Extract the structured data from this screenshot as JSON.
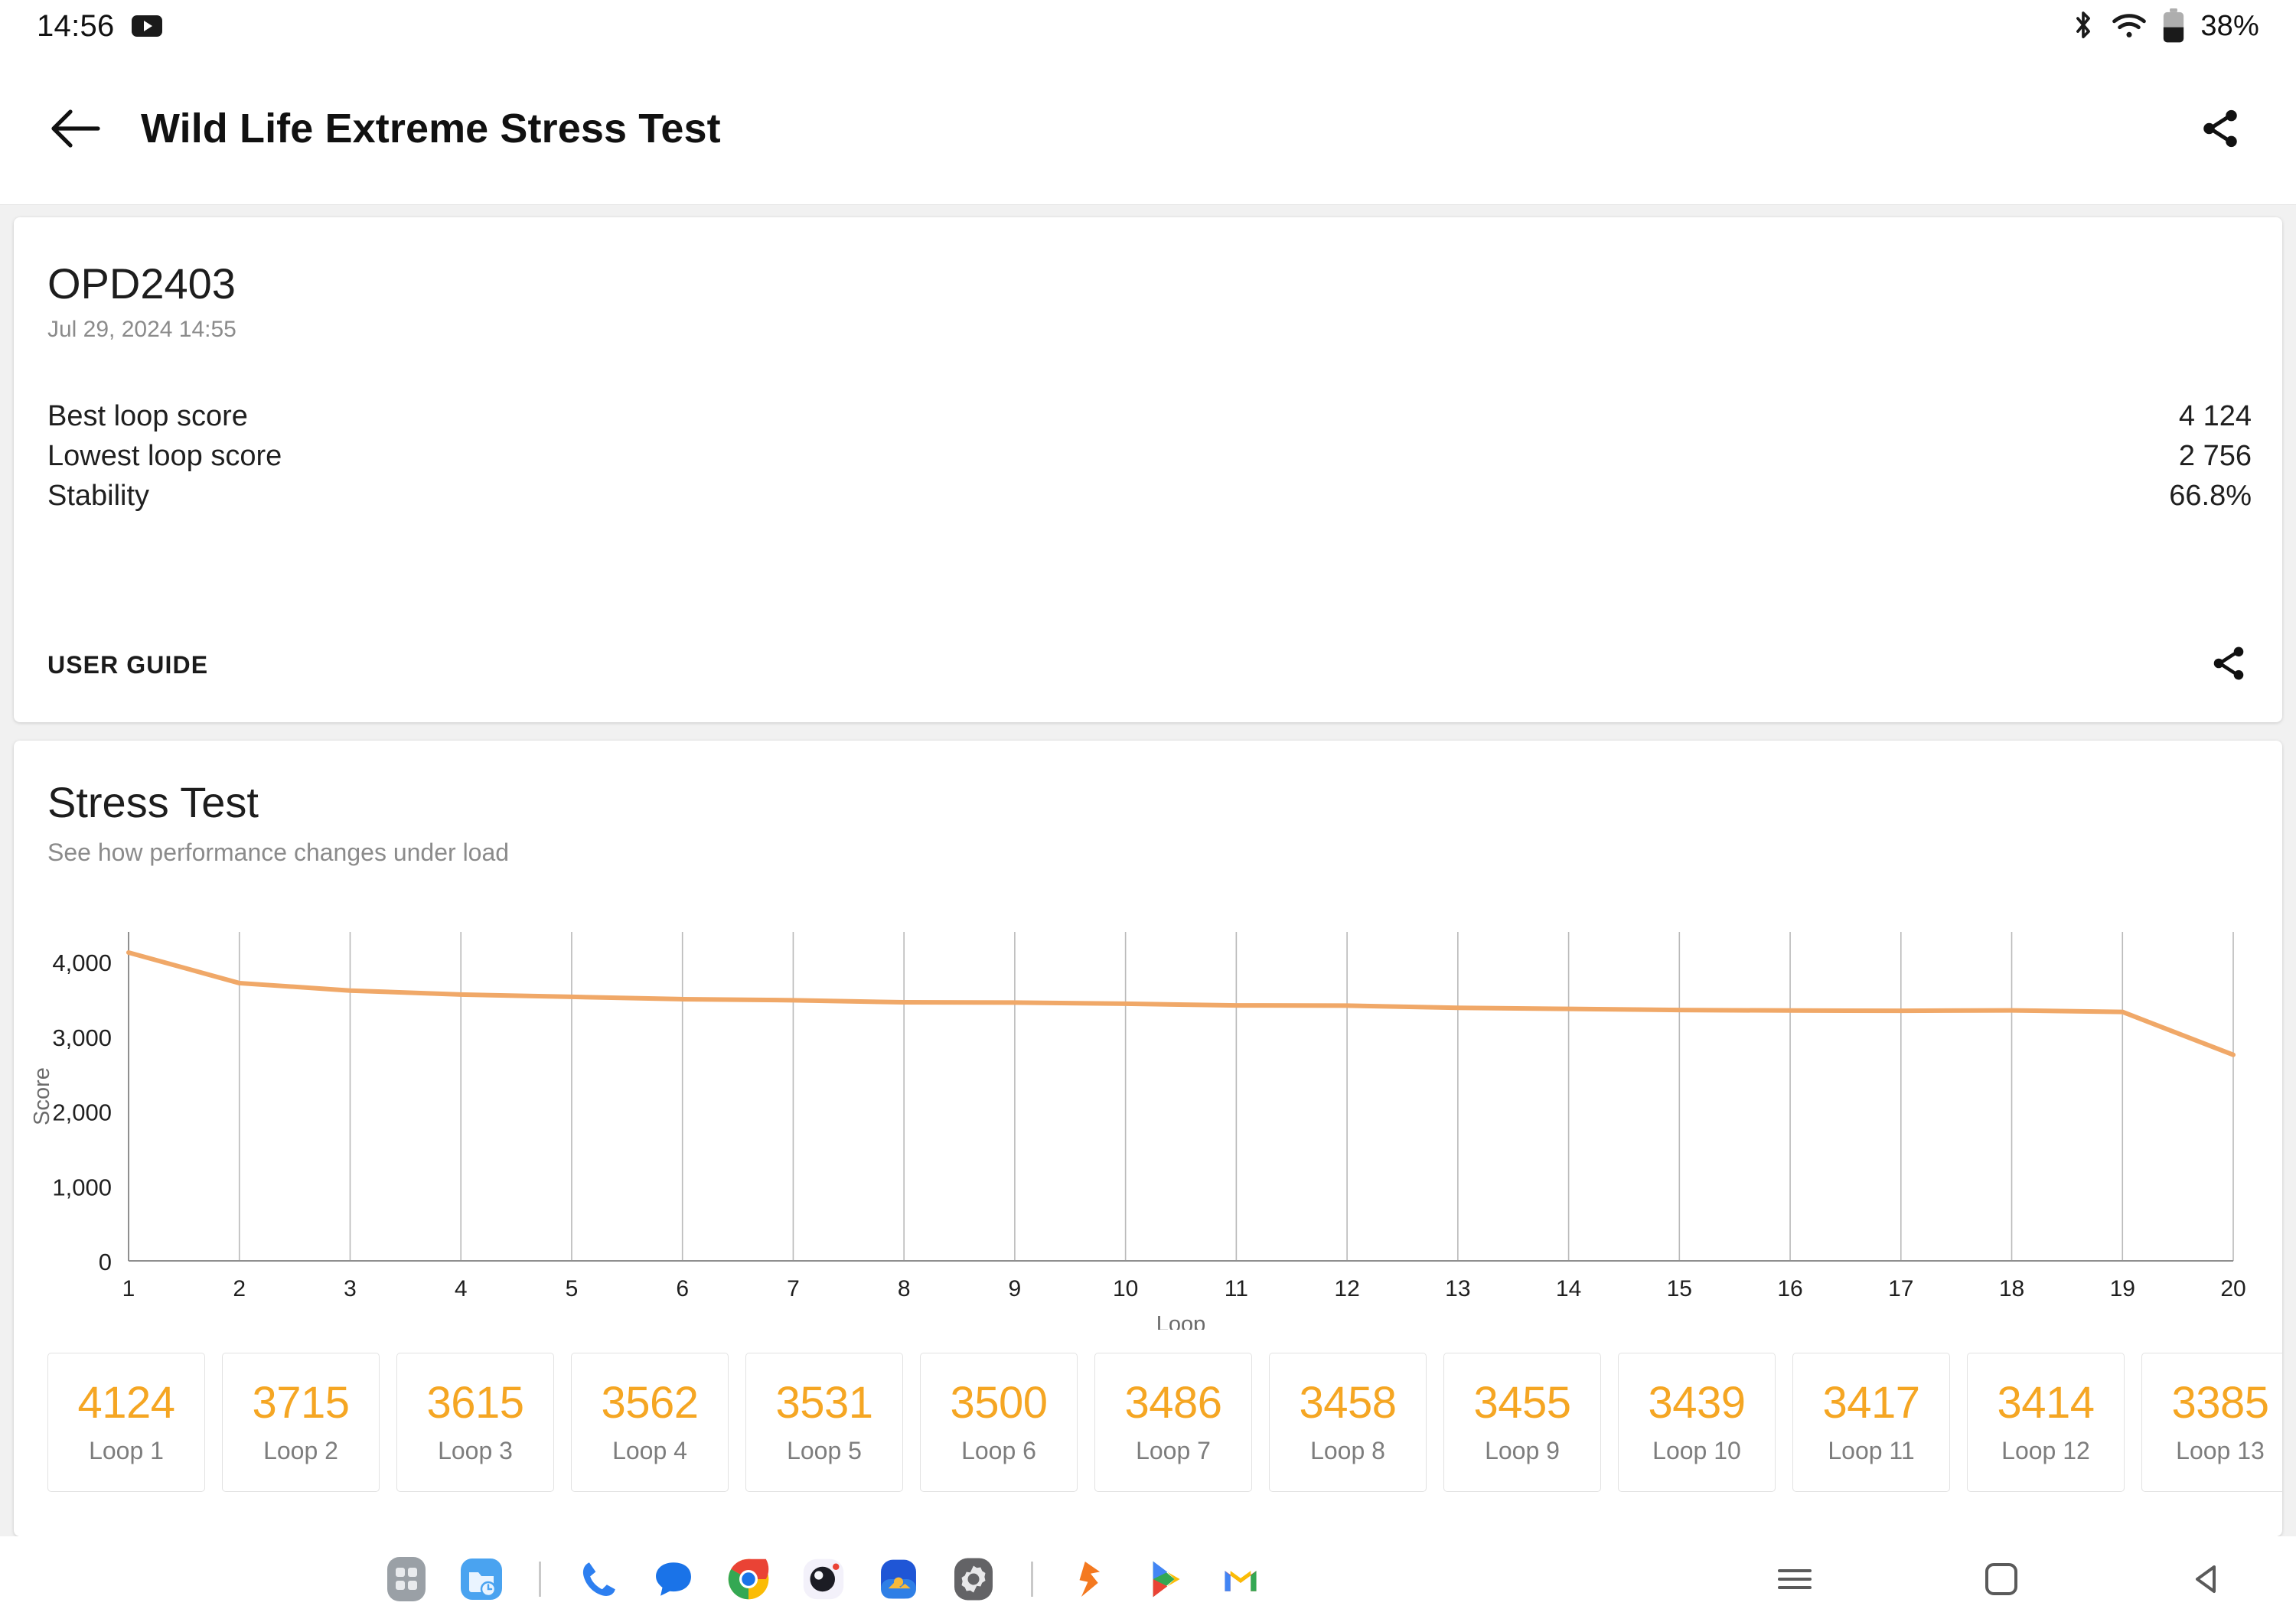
{
  "status_bar": {
    "time": "14:56",
    "youtube_icon": "youtube-icon",
    "bluetooth_icon": "bluetooth-icon",
    "wifi_icon": "wifi-icon",
    "battery_icon": "battery-icon",
    "battery_text": "38%"
  },
  "app_bar": {
    "back_icon": "back-arrow-icon",
    "title": "Wild Life Extreme Stress Test",
    "share_icon": "share-icon"
  },
  "result_card": {
    "device_name": "OPD2403",
    "timestamp": "Jul 29, 2024 14:55",
    "rows": [
      {
        "label": "Best loop score",
        "value": "4 124"
      },
      {
        "label": "Lowest loop score",
        "value": "2 756"
      },
      {
        "label": "Stability",
        "value": "66.8%"
      }
    ],
    "user_guide_label": "USER GUIDE",
    "share_icon": "share-icon"
  },
  "stress_card": {
    "title": "Stress Test",
    "subtitle": "See how performance changes under load",
    "loop_cards": [
      {
        "score": "4124",
        "label": "Loop 1"
      },
      {
        "score": "3715",
        "label": "Loop 2"
      },
      {
        "score": "3615",
        "label": "Loop 3"
      },
      {
        "score": "3562",
        "label": "Loop 4"
      },
      {
        "score": "3531",
        "label": "Loop 5"
      },
      {
        "score": "3500",
        "label": "Loop 6"
      },
      {
        "score": "3486",
        "label": "Loop 7"
      },
      {
        "score": "3458",
        "label": "Loop 8"
      },
      {
        "score": "3455",
        "label": "Loop 9"
      },
      {
        "score": "3439",
        "label": "Loop 10"
      },
      {
        "score": "3417",
        "label": "Loop 11"
      },
      {
        "score": "3414",
        "label": "Loop 12"
      },
      {
        "score": "3385",
        "label": "Loop 13"
      }
    ]
  },
  "chart_data": {
    "type": "line",
    "title": "",
    "xlabel": "Loop",
    "ylabel": "Score",
    "x": [
      1,
      2,
      3,
      4,
      5,
      6,
      7,
      8,
      9,
      10,
      11,
      12,
      13,
      14,
      15,
      16,
      17,
      18,
      19,
      20
    ],
    "xticklabels": [
      "1",
      "2",
      "3",
      "4",
      "5",
      "6",
      "7",
      "8",
      "9",
      "10",
      "11",
      "12",
      "13",
      "14",
      "15",
      "16",
      "17",
      "18",
      "19",
      "20"
    ],
    "yticklabels": [
      "0",
      "1,000",
      "2,000",
      "3,000",
      "4,000"
    ],
    "yticks": [
      0,
      1000,
      2000,
      3000,
      4000
    ],
    "ylim": [
      0,
      4400
    ],
    "xlim": [
      1,
      20
    ],
    "grid": "vertical",
    "line_color": "#f0a868",
    "series": [
      {
        "name": "Score",
        "values": [
          4124,
          3715,
          3615,
          3562,
          3531,
          3500,
          3486,
          3458,
          3455,
          3439,
          3417,
          3414,
          3385,
          3370,
          3355,
          3348,
          3345,
          3350,
          3330,
          2756
        ]
      }
    ]
  },
  "taskbar": {
    "icons": [
      "app-drawer-icon",
      "files-icon",
      "divider",
      "phone-icon",
      "messages-icon",
      "chrome-icon",
      "camera-icon",
      "photos-icon",
      "settings-icon",
      "divider",
      "3dmark-icon",
      "play-store-icon",
      "gmail-icon"
    ],
    "nav": {
      "recents_icon": "recents-icon",
      "home_icon": "home-icon",
      "back_icon": "back-icon"
    }
  }
}
